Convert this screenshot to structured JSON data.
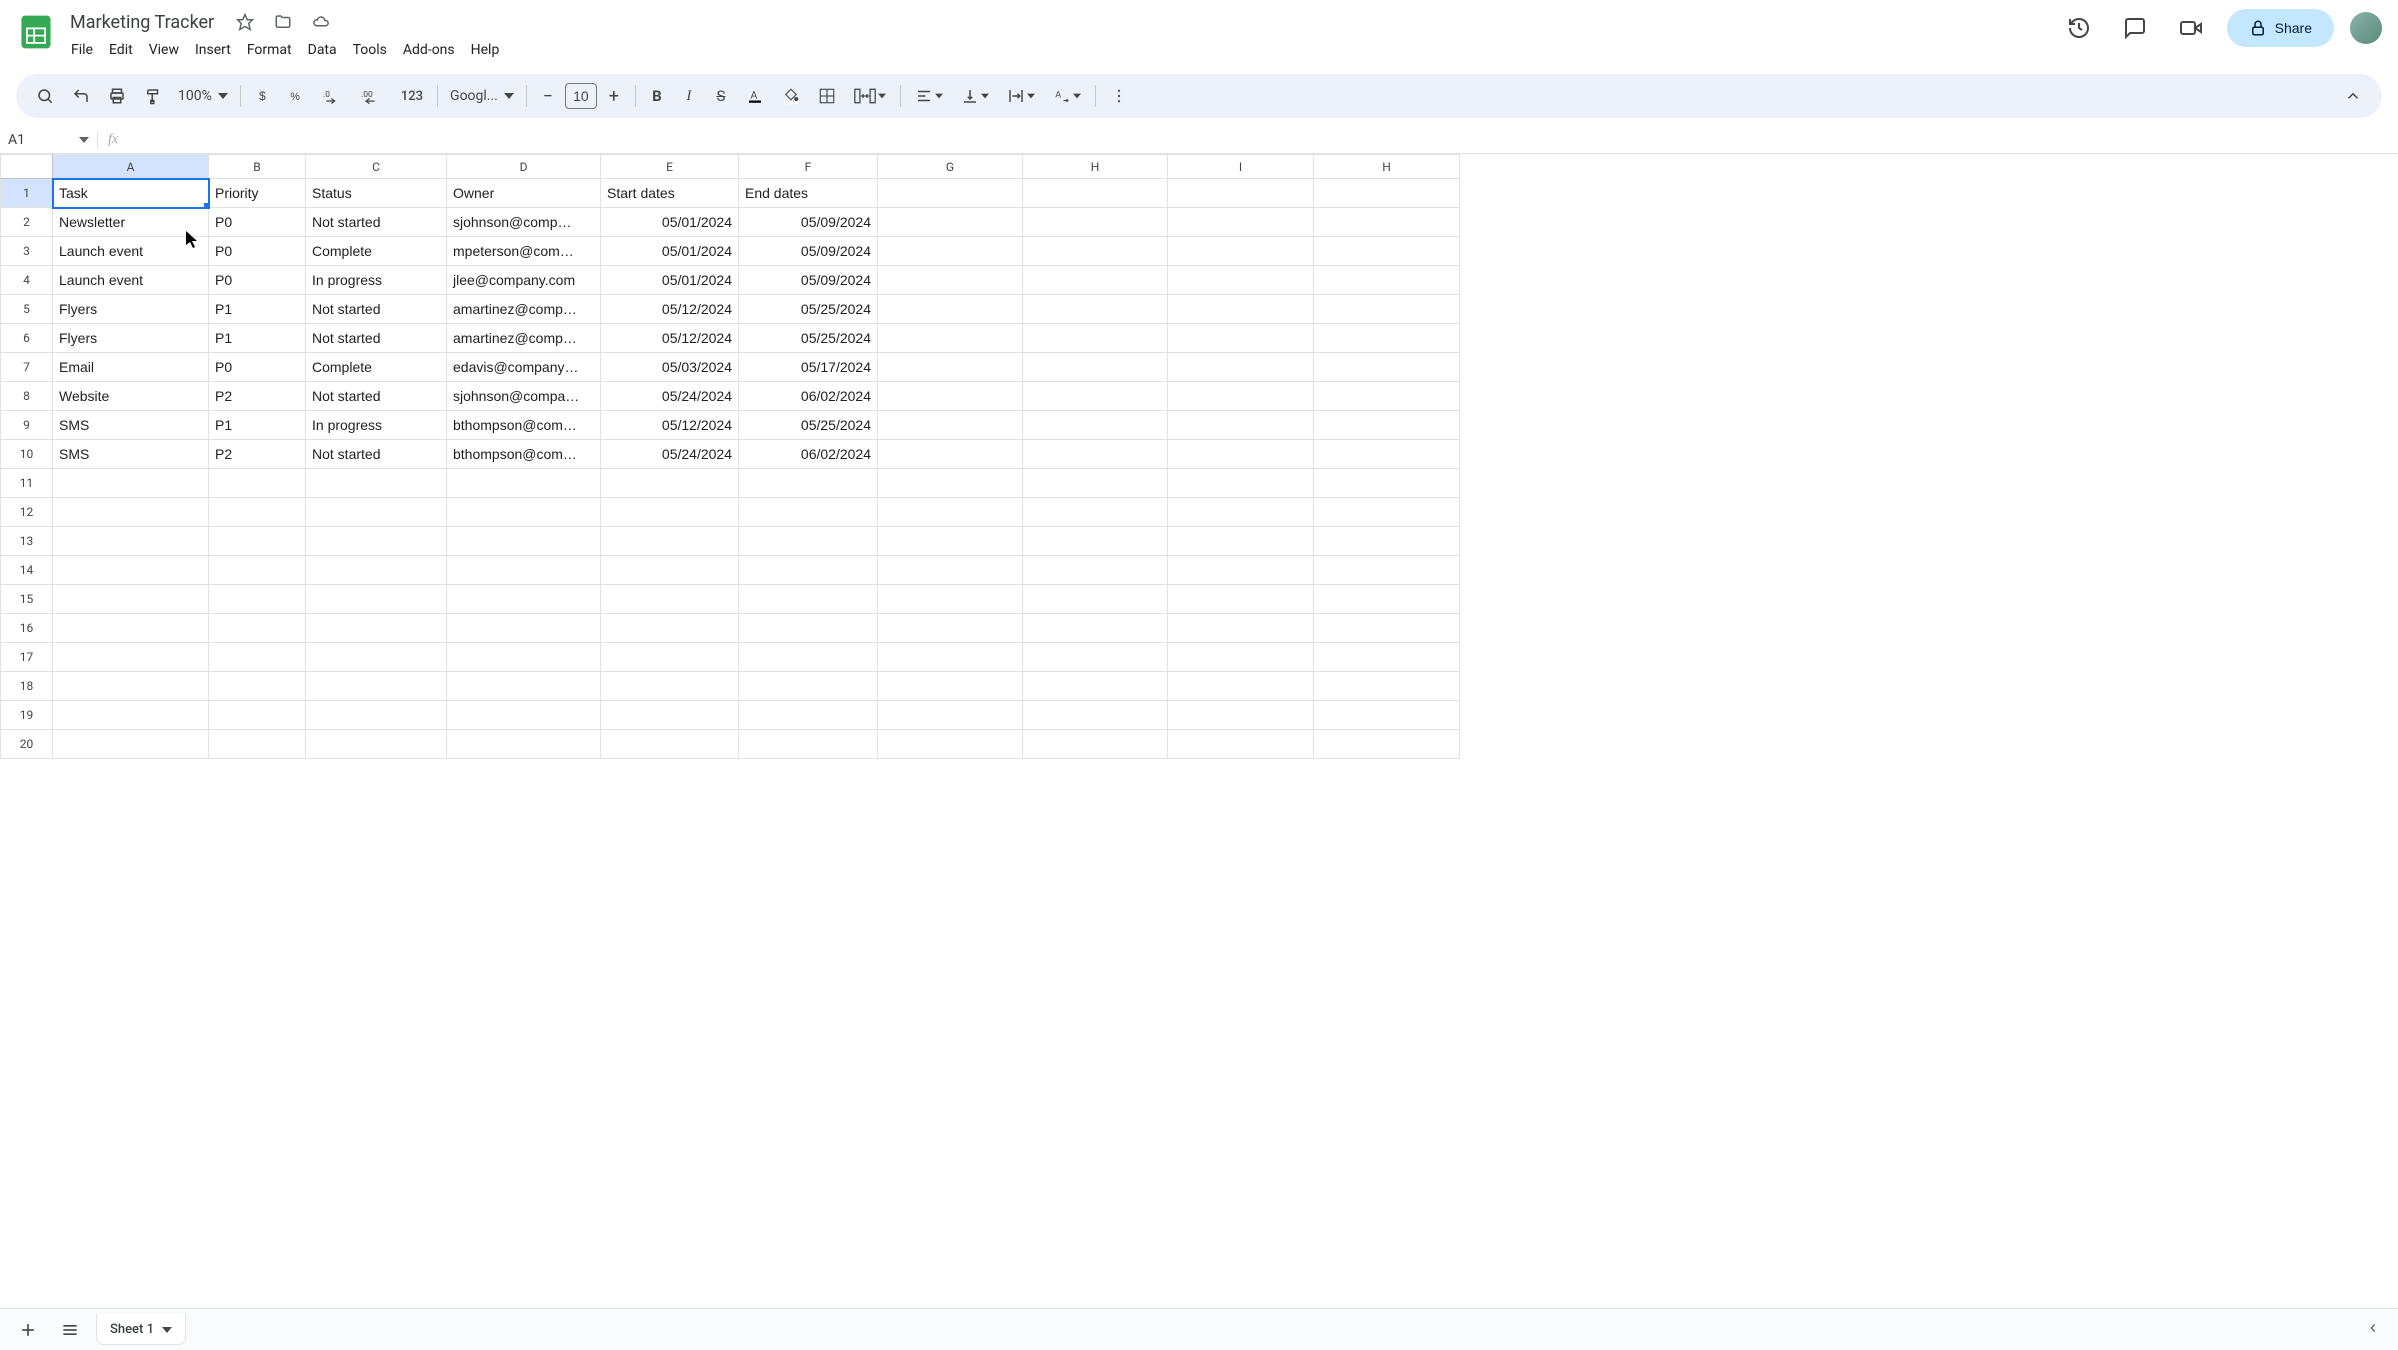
{
  "doc": {
    "title": "Marketing Tracker"
  },
  "menu": {
    "file": "File",
    "edit": "Edit",
    "view": "View",
    "insert": "Insert",
    "format": "Format",
    "data": "Data",
    "tools": "Tools",
    "addons": "Add-ons",
    "help": "Help"
  },
  "header": {
    "share": "Share"
  },
  "toolbar": {
    "zoom": "100%",
    "font": "Googl...",
    "font_size": "10"
  },
  "namebox": {
    "ref": "A1"
  },
  "columns": [
    "A",
    "B",
    "C",
    "D",
    "E",
    "F",
    "G",
    "H",
    "I",
    "H"
  ],
  "headers": {
    "task": "Task",
    "priority": "Priority",
    "status": "Status",
    "owner": "Owner",
    "start": "Start dates",
    "end": "End dates"
  },
  "rows": [
    {
      "task": "Newsletter",
      "priority": "P0",
      "status": "Not started",
      "owner": "sjohnson@comp…",
      "start": "05/01/2024",
      "end": "05/09/2024"
    },
    {
      "task": "Launch event",
      "priority": "P0",
      "status": "Complete",
      "owner": "mpeterson@com…",
      "start": "05/01/2024",
      "end": "05/09/2024"
    },
    {
      "task": "Launch event",
      "priority": "P0",
      "status": "In progress",
      "owner": "jlee@company.com",
      "start": "05/01/2024",
      "end": "05/09/2024"
    },
    {
      "task": "Flyers",
      "priority": "P1",
      "status": "Not started",
      "owner": "amartinez@comp…",
      "start": "05/12/2024",
      "end": "05/25/2024"
    },
    {
      "task": "Flyers",
      "priority": "P1",
      "status": "Not started",
      "owner": "amartinez@comp…",
      "start": "05/12/2024",
      "end": "05/25/2024"
    },
    {
      "task": "Email",
      "priority": "P0",
      "status": "Complete",
      "owner": "edavis@company…",
      "start": "05/03/2024",
      "end": "05/17/2024"
    },
    {
      "task": "Website",
      "priority": "P2",
      "status": "Not started",
      "owner": "sjohnson@compa…",
      "start": "05/24/2024",
      "end": "06/02/2024"
    },
    {
      "task": "SMS",
      "priority": "P1",
      "status": "In progress",
      "owner": "bthompson@com…",
      "start": "05/12/2024",
      "end": "05/25/2024"
    },
    {
      "task": "SMS",
      "priority": "P2",
      "status": "Not started",
      "owner": "bthompson@com…",
      "start": "05/24/2024",
      "end": "06/02/2024"
    }
  ],
  "sheet": {
    "tab": "Sheet 1"
  },
  "row_labels": [
    "1",
    "2",
    "3",
    "4",
    "5",
    "6",
    "7",
    "8",
    "9",
    "10",
    "11",
    "12",
    "13",
    "14",
    "15",
    "16",
    "17",
    "18",
    "19",
    "20"
  ]
}
